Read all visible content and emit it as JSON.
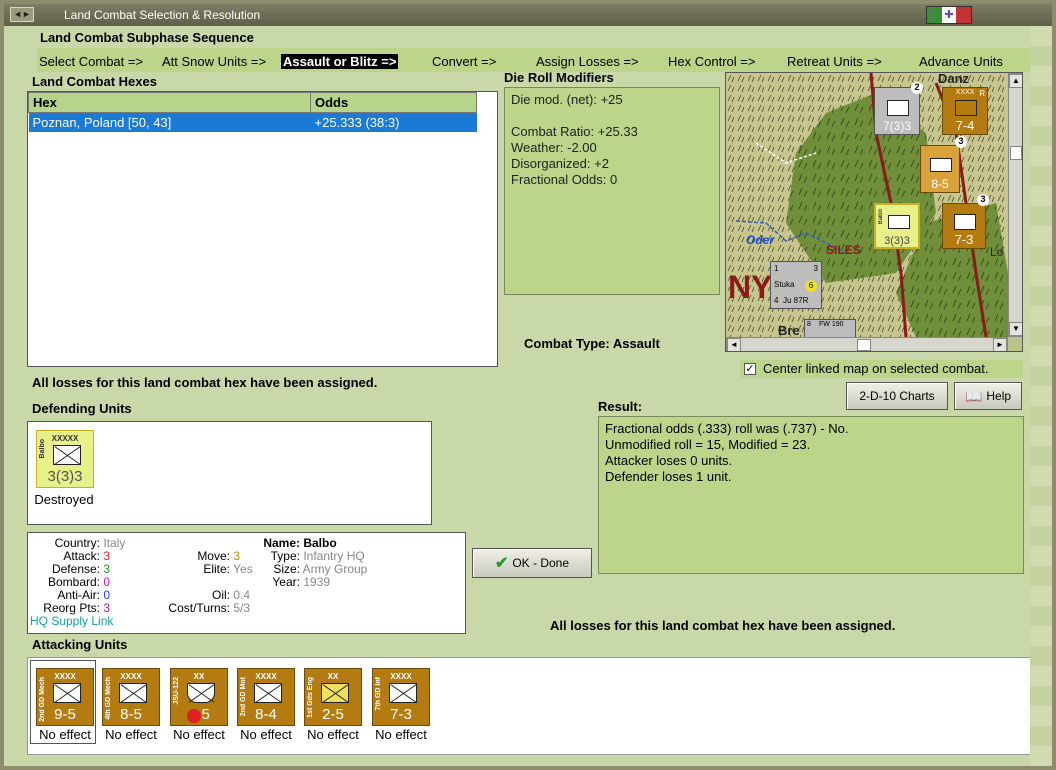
{
  "window": {
    "title": "Land Combat Selection & Resolution",
    "sys": "◄►"
  },
  "sequence": {
    "title": "Land Combat Subphase Sequence",
    "steps": [
      "Select Combat =>",
      "Att Snow Units =>",
      "Assault or Blitz =>",
      "Convert =>",
      "Assign Losses =>",
      "Hex Control =>",
      "Retreat Units =>",
      "Advance Units"
    ],
    "active": "Assault or Blitz =>"
  },
  "hexes": {
    "title": "Land Combat Hexes",
    "col_hex": "Hex",
    "col_odds": "Odds",
    "rows": [
      {
        "hex": "Poznan, Poland [50, 43]",
        "odds": "+25.333 (38:3)"
      }
    ]
  },
  "modifiers": {
    "title": "Die Roll Modifiers",
    "net": "Die mod. (net): +25",
    "ratio": "Combat Ratio: +25.33",
    "weather": "Weather: -2.00",
    "disorg": "Disorganized: +2",
    "fract": "Fractional Odds: 0"
  },
  "map": {
    "label_oder": "Oder",
    "label_siles": "SILES",
    "label_ny": "NY",
    "label_danz": "Danz",
    "label_bre": "Bre",
    "label_lo": "Lo",
    "counters": [
      {
        "name": "",
        "str": "7(3)3",
        "num": "2"
      },
      {
        "name": "",
        "str": "7-4",
        "num": "",
        "sz": "XXXX",
        "tag": "R"
      },
      {
        "name": "",
        "str": "8-5",
        "num": "3"
      },
      {
        "name": "Balbo",
        "str": "3(3)3",
        "num": ""
      },
      {
        "name": "",
        "str": "7-3",
        "num": "3"
      }
    ],
    "air": {
      "top": "1",
      "right": "3",
      "name": "Stuka",
      "sub": "Ju 87R",
      "bot": "4",
      "dot": "6"
    },
    "air2": "FW 190",
    "air2b": "8"
  },
  "combat_type": "Combat Type:  Assault",
  "center_map": {
    "label": "Center linked map on selected combat.",
    "checked": true
  },
  "losses_msg": "All losses for this land combat hex have been assigned.",
  "defending": {
    "title": "Defending Units",
    "units": [
      {
        "name": "Balbo",
        "size": "XXXXX",
        "strength": "3(3)3",
        "status": "Destroyed"
      }
    ]
  },
  "unit_info": {
    "country_k": "Country:",
    "country_v": "Italy",
    "attack_k": "Attack:",
    "attack_v": "3",
    "defense_k": "Defense:",
    "defense_v": "3",
    "bombard_k": "Bombard:",
    "bombard_v": "0",
    "antiair_k": "Anti-Air:",
    "antiair_v": "0",
    "reorg_k": "Reorg Pts:",
    "reorg_v": "3",
    "hq": "HQ Supply Link",
    "name_k": "Name:",
    "name_v": "Balbo",
    "move_k": "Move:",
    "move_v": "3",
    "type_k": "Type:",
    "type_v": "Infantry HQ",
    "elite_k": "Elite:",
    "elite_v": "Yes",
    "size_k": "Size:",
    "size_v": "Army Group",
    "year_k": "Year:",
    "year_v": "1939",
    "oil_k": "Oil:",
    "oil_v": "0.4",
    "cost_k": "Cost/Turns:",
    "cost_v": "5/3"
  },
  "buttons": {
    "charts": "2-D-10 Charts",
    "help": "Help",
    "ok": "OK - Done"
  },
  "result": {
    "title": "Result:",
    "lines": [
      "Fractional odds (.333) roll was (.737)  - No.",
      "Unmodified roll = 15, Modified = 23.",
      "Attacker loses 0 units.",
      "Defender loses 1 unit."
    ]
  },
  "attacking": {
    "title": "Attacking Units",
    "units": [
      {
        "name": "2nd GD Mech",
        "size": "XXXX",
        "strength": "9-5",
        "status": "No effect"
      },
      {
        "name": "4th GD Mech",
        "size": "XXXX",
        "strength": "8-5",
        "status": "No effect"
      },
      {
        "name": "JSU-122",
        "size": "XX",
        "strength": "4-5",
        "status": "No effect"
      },
      {
        "name": "2nd GD Mot",
        "size": "XXXX",
        "strength": "8-4",
        "status": "No effect"
      },
      {
        "name": "1st Gds Eng",
        "size": "XX",
        "strength": "2-5",
        "status": "No effect"
      },
      {
        "name": "7th GD Inf",
        "size": "XXXX",
        "strength": "7-3",
        "status": "No effect"
      }
    ]
  },
  "colors": {
    "bg": "#c9d8a8",
    "panel_green": "#bcd58a",
    "unit_gold": "#b47c10",
    "selected": "#1a7ad4"
  }
}
